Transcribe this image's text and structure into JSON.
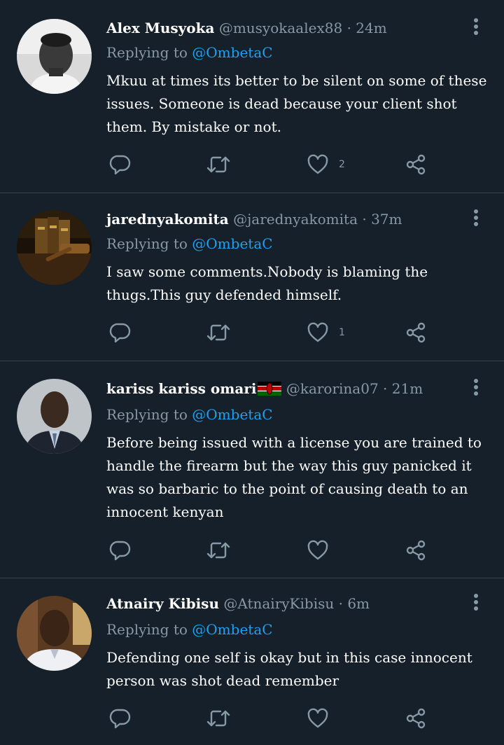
{
  "colors": {
    "background": "#15202b",
    "divider": "#38444d",
    "secondary_text": "#8899a6",
    "mention": "#1da1f2",
    "primary_text": "#ffffff"
  },
  "replying_label": "Replying to",
  "tweets": [
    {
      "name": "Alex Musyoka",
      "handle": "@musyokaalex88",
      "separator": "·",
      "time": "24m",
      "reply_to": "@OmbetaC",
      "text": "Mkuu at times its better to be silent on some of these issues. Someone is dead because your client shot them. By mistake or not.",
      "likes": "2",
      "avatar": "avatar-man-grayscale"
    },
    {
      "name": "jarednyakomita",
      "handle": "@jarednyakomita",
      "separator": "·",
      "time": "37m",
      "reply_to": "@OmbetaC",
      "text": "I saw some comments.Nobody is blaming the thugs.This guy defended himself.",
      "likes": "1",
      "avatar": "avatar-law-books-gavel"
    },
    {
      "name": "kariss kariss omari",
      "handle": "@karorina07",
      "separator": "·",
      "time": "21m",
      "reply_to": "@OmbetaC",
      "text": "Before being issued with a license you are trained to handle the firearm but the way this guy panicked it was so barbaric to the point of causing death to an innocent kenyan",
      "likes": "",
      "avatar": "avatar-man-suit",
      "flag": "kenya-flag-emoji"
    },
    {
      "name": "Atnairy Kibisu",
      "handle": "@AtnairyKibisu",
      "separator": "·",
      "time": "6m",
      "reply_to": "@OmbetaC",
      "text": "Defending one self is okay but in this case innocent person was shot dead remember",
      "likes": "",
      "avatar": "avatar-man-white-shirt"
    }
  ]
}
